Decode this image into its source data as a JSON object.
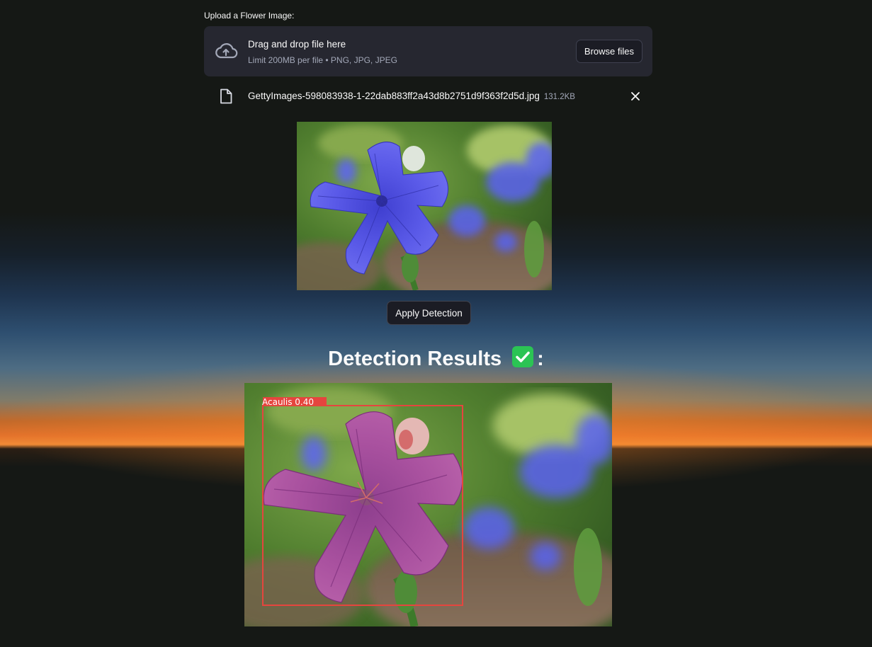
{
  "uploader": {
    "label": "Upload a Flower Image:",
    "dropzone_title": "Drag and drop file here",
    "dropzone_subtitle": "Limit 200MB per file • PNG, JPG, JPEG",
    "browse_label": "Browse files",
    "icon": "cloud-upload-icon"
  },
  "uploaded_file": {
    "name": "GettyImages-598083938-1-22dab883ff2a43d8b2751d9f363f2d5d.jpg",
    "size": "131.2KB",
    "icon": "file-icon",
    "remove_icon": "close-icon"
  },
  "uploaded_image": {
    "subject": "blue balloon flower photo"
  },
  "actions": {
    "apply_label": "Apply Detection"
  },
  "results": {
    "title": "Detection Results",
    "title_suffix": ":",
    "icon": "check-mark-button-icon",
    "detection_label": "Acaulis 0.40",
    "box_color": "#e5453e"
  }
}
